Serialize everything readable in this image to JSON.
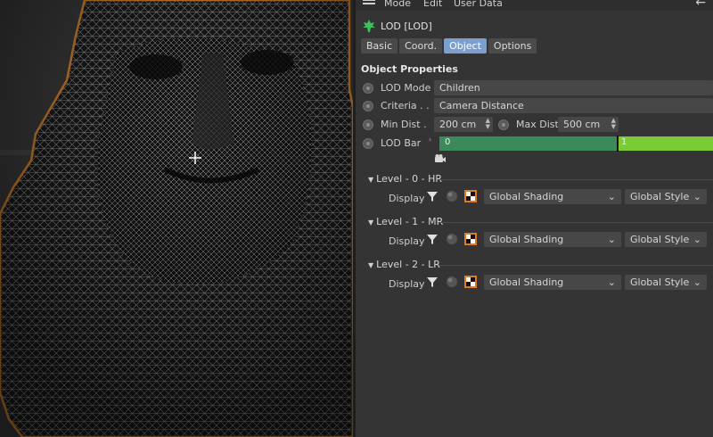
{
  "menu": {
    "items": [
      "Mode",
      "Edit",
      "User Data"
    ]
  },
  "object": {
    "title": "LOD [LOD]",
    "icon": "lod-leaf-icon",
    "icon_color": "#3fbf5a"
  },
  "tabs": [
    {
      "label": "Basic",
      "active": false
    },
    {
      "label": "Coord.",
      "active": false
    },
    {
      "label": "Object",
      "active": true
    },
    {
      "label": "Options",
      "active": false
    }
  ],
  "section_title": "Object Properties",
  "props": {
    "lod_mode": {
      "label": "LOD Mode",
      "value": "Children"
    },
    "criteria": {
      "label": "Criteria . .",
      "value": "Camera Distance"
    },
    "min_dist": {
      "label": "Min Dist .",
      "value": "200 cm"
    },
    "max_dist": {
      "label": "Max Dist",
      "value": "500 cm"
    },
    "lod_bar": {
      "label": "LOD Bar",
      "seg0_label": "0",
      "seg1_label": "1",
      "seg0_fraction": 0.65,
      "seg0_color": "#3c8a5a",
      "seg1_color": "#7acb35"
    }
  },
  "levels": [
    {
      "title": "Level - 0 - HR",
      "display_label": "Display",
      "shading": "Global Shading",
      "style": "Global Style"
    },
    {
      "title": "Level - 1 - MR",
      "display_label": "Display",
      "shading": "Global Shading",
      "style": "Global Style"
    },
    {
      "title": "Level - 2 - LR",
      "display_label": "Display",
      "shading": "Global Shading",
      "style": "Global Style"
    }
  ],
  "viewport": {
    "selection_outline_color": "#e08a2c"
  }
}
